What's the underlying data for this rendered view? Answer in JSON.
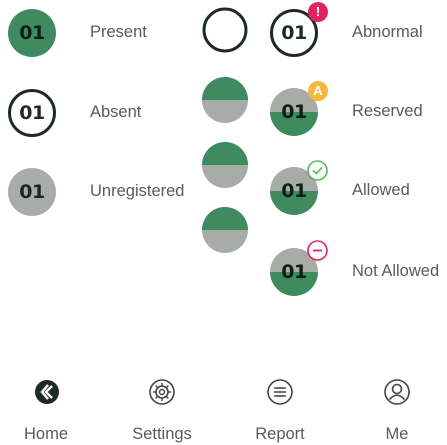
{
  "legend_left": [
    {
      "badge": "01",
      "label": "Present",
      "style": "present"
    },
    {
      "badge": "01",
      "label": "Absent",
      "style": "absent"
    },
    {
      "badge": "01",
      "label": "Unregistered",
      "style": "unregistered"
    }
  ],
  "legend_right": [
    {
      "badge": "01",
      "label": "Abnormal",
      "indicator": "!",
      "indicator_color": "#e0245e"
    },
    {
      "badge": "01",
      "label": "Reserved",
      "indicator": "A",
      "indicator_color": "#f5b83d"
    },
    {
      "badge": "01",
      "label": "Allowed",
      "indicator": "check",
      "indicator_color": "#5cb85c"
    },
    {
      "badge": "01",
      "label": "Not Allowed",
      "indicator": "minus",
      "indicator_color": "#e0245e"
    }
  ],
  "nav": [
    {
      "label": "Home",
      "icon": "home-icon"
    },
    {
      "label": "Settings",
      "icon": "settings-icon"
    },
    {
      "label": "Report",
      "icon": "report-icon"
    },
    {
      "label": "Me",
      "icon": "me-icon"
    }
  ],
  "colors": {
    "present": "#3f8a5f",
    "unregistered": "#a8aca9",
    "dark": "#1e2a24"
  }
}
